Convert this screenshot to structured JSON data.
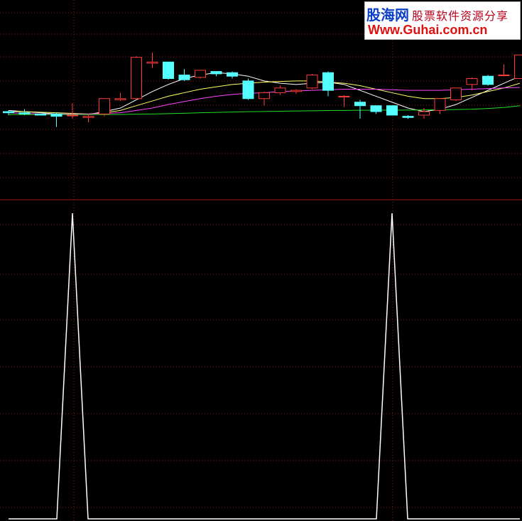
{
  "watermark": {
    "logo": "股海网",
    "slogan": "股票软件资源分享",
    "url": "Www.Guhai.com.cn"
  },
  "colors": {
    "background": "#000000",
    "grid": "#8a1a1a",
    "divider": "#a01414",
    "up_candle": "#ff3b3b",
    "down_candle": "#54ffff",
    "ma_short": "#ffffff",
    "ma_mid": "#ffff66",
    "ma_long": "#ff44ff",
    "ma_longest": "#22dd22",
    "indicator_line": "#ffffff"
  },
  "chart_data": [
    {
      "type": "candlestick",
      "title": "",
      "xlabel": "",
      "ylabel": "",
      "grid": true,
      "ylim": [
        0,
        100
      ],
      "candles": [
        {
          "o": 50,
          "h": 51,
          "l": 47,
          "c": 49
        },
        {
          "o": 49,
          "h": 52,
          "l": 47,
          "c": 48
        },
        {
          "o": 48,
          "h": 48,
          "l": 47,
          "c": 47
        },
        {
          "o": 48,
          "h": 49,
          "l": 37,
          "c": 46
        },
        {
          "o": 47,
          "h": 57,
          "l": 44,
          "c": 47
        },
        {
          "o": 45,
          "h": 48,
          "l": 41,
          "c": 46
        },
        {
          "o": 48,
          "h": 54,
          "l": 46,
          "c": 61
        },
        {
          "o": 60,
          "h": 66,
          "l": 59,
          "c": 61
        },
        {
          "o": 61,
          "h": 97,
          "l": 60,
          "c": 96
        },
        {
          "o": 91,
          "h": 100,
          "l": 87,
          "c": 92
        },
        {
          "o": 92,
          "h": 92,
          "l": 77,
          "c": 78
        },
        {
          "o": 81,
          "h": 86,
          "l": 76,
          "c": 77
        },
        {
          "o": 79,
          "h": 85,
          "l": 78,
          "c": 85
        },
        {
          "o": 84,
          "h": 84,
          "l": 80,
          "c": 82
        },
        {
          "o": 83,
          "h": 84,
          "l": 78,
          "c": 80
        },
        {
          "o": 76,
          "h": 78,
          "l": 60,
          "c": 61
        },
        {
          "o": 61,
          "h": 67,
          "l": 55,
          "c": 66
        },
        {
          "o": 66,
          "h": 72,
          "l": 64,
          "c": 70
        },
        {
          "o": 67,
          "h": 69,
          "l": 65,
          "c": 68
        },
        {
          "o": 70,
          "h": 82,
          "l": 69,
          "c": 81
        },
        {
          "o": 83,
          "h": 84,
          "l": 63,
          "c": 68
        },
        {
          "o": 63,
          "h": 64,
          "l": 54,
          "c": 63
        },
        {
          "o": 58,
          "h": 60,
          "l": 44,
          "c": 55
        },
        {
          "o": 55,
          "h": 55,
          "l": 48,
          "c": 50
        },
        {
          "o": 55,
          "h": 55,
          "l": 47,
          "c": 47
        },
        {
          "o": 46,
          "h": 47,
          "l": 44,
          "c": 45
        },
        {
          "o": 47,
          "h": 53,
          "l": 44,
          "c": 50
        },
        {
          "o": 51,
          "h": 61,
          "l": 48,
          "c": 61
        },
        {
          "o": 60,
          "h": 70,
          "l": 59,
          "c": 70
        },
        {
          "o": 73,
          "h": 79,
          "l": 68,
          "c": 78
        },
        {
          "o": 80,
          "h": 81,
          "l": 72,
          "c": 73
        },
        {
          "o": 81,
          "h": 90,
          "l": 80,
          "c": 81
        },
        {
          "o": 78,
          "h": 93,
          "l": 78,
          "c": 98
        }
      ],
      "series": [
        {
          "color_key": "ma_short",
          "values": [
            51,
            50,
            49,
            48,
            48,
            47.5,
            50,
            53,
            60,
            67,
            73,
            78,
            81,
            83,
            82,
            80,
            76,
            74,
            73,
            74,
            75,
            73,
            68,
            63,
            58,
            53,
            50,
            52,
            56,
            62,
            68,
            74,
            80
          ]
        },
        {
          "color_key": "ma_mid",
          "values": [
            50,
            50,
            49.5,
            49,
            48.5,
            48,
            49,
            51,
            55,
            59,
            63,
            66,
            69,
            71,
            73,
            74,
            75,
            75.5,
            76,
            76,
            75,
            74,
            72,
            69,
            66,
            63,
            61,
            61,
            62,
            64,
            67,
            70,
            74
          ]
        },
        {
          "color_key": "ma_long",
          "values": [
            49,
            48.5,
            48,
            48,
            48,
            48,
            48.5,
            49,
            51,
            53,
            56,
            58.5,
            61,
            63,
            64.5,
            65.5,
            66,
            67,
            67.5,
            68,
            68.5,
            69,
            69,
            69,
            68.5,
            68,
            68,
            68,
            68.5,
            69,
            69.5,
            70,
            70.5
          ]
        },
        {
          "color_key": "ma_longest",
          "values": [
            47.5,
            47.5,
            47.5,
            47.5,
            47.5,
            47.5,
            47.5,
            47.6,
            47.8,
            48,
            48.3,
            48.6,
            49,
            49.3,
            49.6,
            49.9,
            50.1,
            50.3,
            50.5,
            50.7,
            50.9,
            51,
            51.1,
            51.2,
            51.2,
            51.3,
            51.4,
            51.5,
            51.7,
            52,
            52.6,
            53.5,
            55
          ]
        }
      ]
    },
    {
      "type": "line",
      "title": "",
      "xlabel": "",
      "ylabel": "",
      "grid": true,
      "ylim": [
        0,
        1
      ],
      "series": [
        {
          "color_key": "indicator_line",
          "values": [
            0,
            0,
            0,
            0,
            1,
            0,
            0,
            0,
            0,
            0,
            0,
            0,
            0,
            0,
            0,
            0,
            0,
            0,
            0,
            0,
            0,
            0,
            0,
            0,
            1,
            0,
            0,
            0,
            0,
            0,
            0,
            0,
            0
          ]
        }
      ]
    }
  ]
}
